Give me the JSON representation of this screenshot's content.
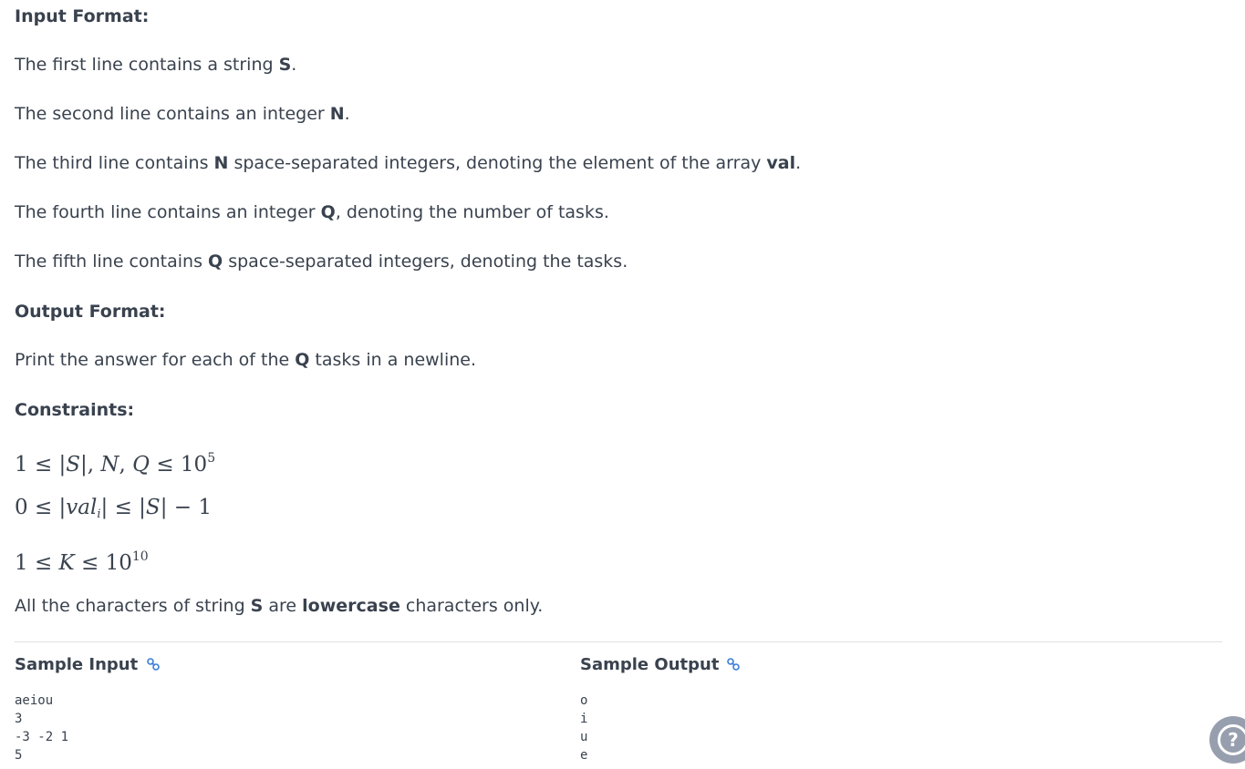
{
  "input_format": {
    "heading": "Input Format:",
    "line1": {
      "pre": "The first line contains a string ",
      "bold": "S",
      "post": "."
    },
    "line2": {
      "pre": "The second line contains an integer ",
      "bold": "N",
      "post": "."
    },
    "line3": {
      "pre": "The third line contains ",
      "bold": "N",
      "mid": " space-separated integers, denoting the element of the array ",
      "bold2": "val",
      "post": "."
    },
    "line4": {
      "pre": "The fourth line contains an integer ",
      "bold": "Q",
      "post": ", denoting the number of tasks."
    },
    "line5": {
      "pre": "The fifth line contains ",
      "bold": "Q",
      "post": " space-separated integers, denoting the tasks."
    }
  },
  "output_format": {
    "heading": "Output Format:",
    "line1": {
      "pre": "Print the answer for each of the ",
      "bold": "Q",
      "post": " tasks in a newline."
    }
  },
  "constraints": {
    "heading": "Constraints:",
    "c1": {
      "a": "1 ≤ |",
      "v1": "S",
      "b": "|, ",
      "v2": "N",
      "c": ", ",
      "v3": "Q",
      "d": " ≤ 10",
      "exp": "5"
    },
    "c2": {
      "a": "0 ≤ |",
      "v1": "val",
      "sub": "i",
      "b": "| ≤ |",
      "v2": "S",
      "c": "| − 1"
    },
    "c3": {
      "a": "1 ≤ ",
      "v1": "K",
      "b": " ≤ 10",
      "exp": "10"
    },
    "note": {
      "pre": "All the characters of string ",
      "bold": "S",
      "mid": " are ",
      "bold2": "lowercase",
      "post": " characters only."
    }
  },
  "sample_input": {
    "title": "Sample Input",
    "icon": "link-icon",
    "lines": [
      "aeiou",
      "3",
      "-3 -2 1",
      "5"
    ]
  },
  "sample_output": {
    "title": "Sample Output",
    "icon": "link-icon",
    "lines": [
      "o",
      "i",
      "u",
      "e"
    ]
  },
  "help": {
    "label": "?",
    "icon": "help-icon"
  },
  "colors": {
    "text": "#39424e",
    "link": "#1ba94c",
    "link_icon": "#3b7dd8",
    "help_bg": "#979faf",
    "divider": "#e0e0e0"
  }
}
